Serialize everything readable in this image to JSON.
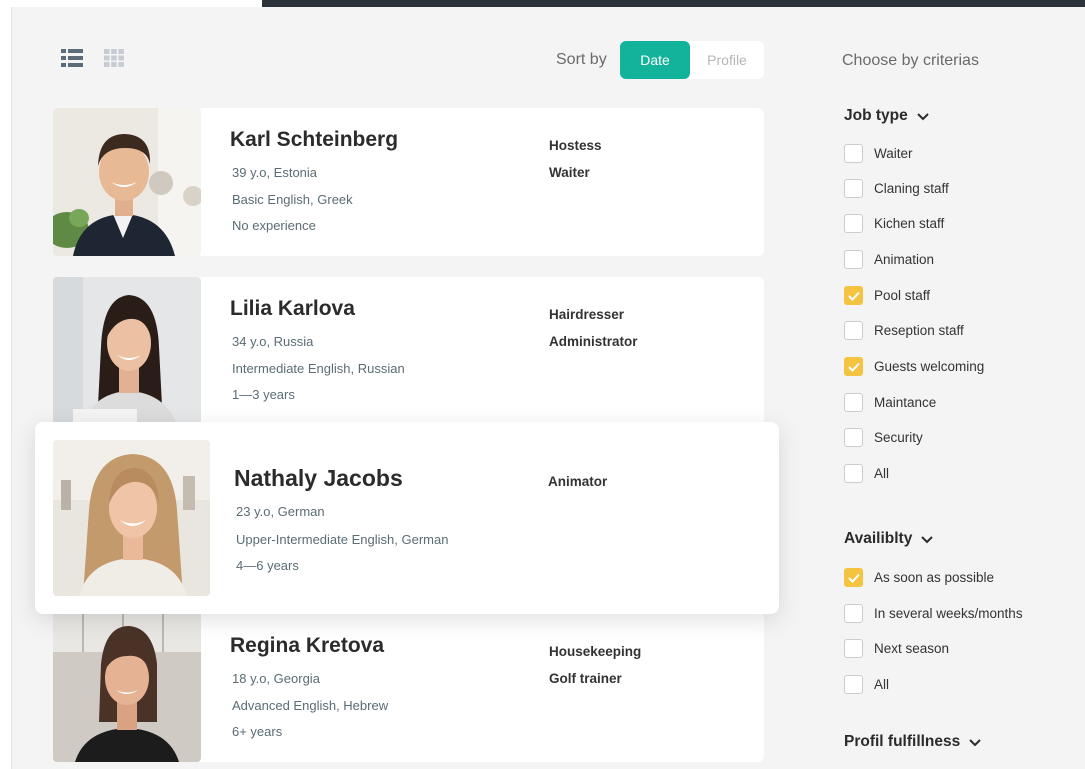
{
  "sort": {
    "label": "Sort by",
    "options": [
      "Date",
      "Profile"
    ],
    "active": "Date"
  },
  "filters": {
    "title": "Choose by criterias",
    "job_type": {
      "title": "Job type",
      "items": [
        {
          "label": "Waiter",
          "checked": false
        },
        {
          "label": "Claning staff",
          "checked": false
        },
        {
          "label": "Kichen staff",
          "checked": false
        },
        {
          "label": "Animation",
          "checked": false
        },
        {
          "label": "Pool staff",
          "checked": true
        },
        {
          "label": "Reseption staff",
          "checked": false
        },
        {
          "label": "Guests welcoming",
          "checked": true
        },
        {
          "label": "Maintance",
          "checked": false
        },
        {
          "label": "Security",
          "checked": false
        },
        {
          "label": "All",
          "checked": false
        }
      ]
    },
    "availability": {
      "title": "Availiblty",
      "items": [
        {
          "label": "As soon as possible",
          "checked": true
        },
        {
          "label": "In several weeks/months",
          "checked": false
        },
        {
          "label": "Next season",
          "checked": false
        },
        {
          "label": "All",
          "checked": false
        }
      ]
    },
    "profile": {
      "title": "Profil fulfillness"
    }
  },
  "candidates": [
    {
      "name": "Karl Schteinberg",
      "age_country": "39 y.o, Estonia",
      "languages": "Basic English, Greek",
      "experience": "No experience",
      "jobs": [
        "Hostess",
        "Waiter"
      ]
    },
    {
      "name": "Lilia Karlova",
      "age_country": "34 y.o, Russia",
      "languages": "Intermediate English, Russian",
      "experience": "1—3 years",
      "jobs": [
        "Hairdresser",
        "Administrator"
      ]
    },
    {
      "name": "Nathaly Jacobs",
      "age_country": "23 y.o, German",
      "languages": "Upper-Intermediate English, German",
      "experience": "4—6 years",
      "jobs": [
        "Animator"
      ]
    },
    {
      "name": "Regina Kretova",
      "age_country": "18 y.o, Georgia",
      "languages": "Advanced English, Hebrew",
      "experience": "6+ years",
      "jobs": [
        "Housekeeping",
        "Golf trainer"
      ]
    }
  ],
  "colors": {
    "accent": "#12b39a",
    "checkbox_checked": "#f4c441",
    "page_bg": "#f4f4f4"
  },
  "icons": [
    "list-view-icon",
    "grid-view-icon",
    "chevron-down-icon",
    "checkmark-icon"
  ]
}
